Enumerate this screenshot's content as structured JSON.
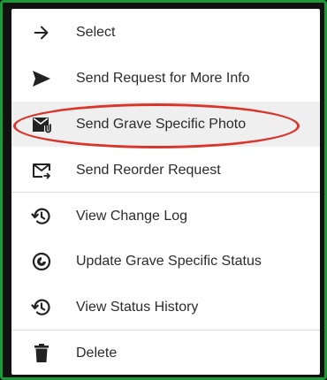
{
  "menu": {
    "items": [
      {
        "label": "Select",
        "icon": "arrow-right-icon"
      },
      {
        "label": "Send Request for More Info",
        "icon": "send-icon"
      },
      {
        "label": "Send Grave Specific Photo",
        "icon": "mail-attachment-icon"
      },
      {
        "label": "Send Reorder Request",
        "icon": "mail-forward-icon"
      },
      {
        "label": "View Change Log",
        "icon": "history-icon"
      },
      {
        "label": "Update Grave Specific Status",
        "icon": "status-icon"
      },
      {
        "label": "View Status History",
        "icon": "history-icon"
      },
      {
        "label": "Delete",
        "icon": "trash-icon"
      }
    ]
  },
  "colors": {
    "frame_border": "#1c9a3a",
    "highlight": "#efefef",
    "annotation": "#d9352b",
    "text": "#2b2b2b"
  }
}
